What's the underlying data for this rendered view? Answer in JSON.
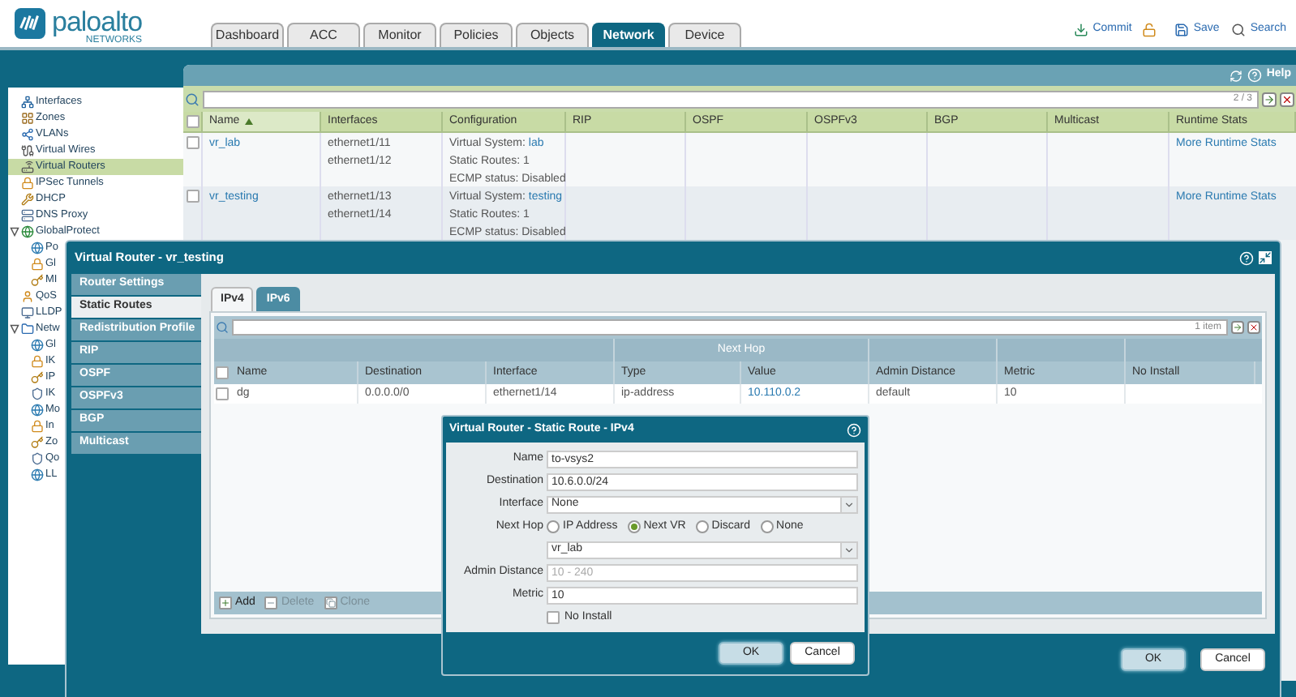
{
  "logo": {
    "brand": "paloalto",
    "sub": "NETWORKS"
  },
  "tabs": [
    {
      "label": "Dashboard",
      "selected": false
    },
    {
      "label": "ACC",
      "selected": false
    },
    {
      "label": "Monitor",
      "selected": false
    },
    {
      "label": "Policies",
      "selected": false
    },
    {
      "label": "Objects",
      "selected": false
    },
    {
      "label": "Network",
      "selected": true
    },
    {
      "label": "Device",
      "selected": false
    }
  ],
  "actions": [
    "Commit",
    "Save",
    "Search"
  ],
  "sidebar": {
    "items": [
      {
        "label": "Interfaces",
        "selected": false
      },
      {
        "label": "Zones",
        "selected": false
      },
      {
        "label": "VLANs",
        "selected": false
      },
      {
        "label": "Virtual Wires",
        "selected": false
      },
      {
        "label": "Virtual Routers",
        "selected": true
      },
      {
        "label": "IPSec Tunnels",
        "selected": false
      },
      {
        "label": "DHCP",
        "selected": false
      },
      {
        "label": "DNS Proxy",
        "selected": false
      },
      {
        "label": "GlobalProtect",
        "selected": false,
        "expanded": true,
        "children": [
          {
            "label": "Po",
            "selected": false
          },
          {
            "label": "Gl",
            "selected": false
          },
          {
            "label": "MI",
            "selected": false
          }
        ]
      },
      {
        "label": "QoS",
        "selected": false
      },
      {
        "label": "LLDP",
        "selected": false
      },
      {
        "label": "Netw",
        "selected": false,
        "expanded": true,
        "children": [
          {
            "label": "Gl",
            "selected": false
          },
          {
            "label": "IK",
            "selected": false
          },
          {
            "label": "IP",
            "selected": false
          },
          {
            "label": "IK",
            "selected": false
          },
          {
            "label": "Mo",
            "selected": false
          },
          {
            "label": "In",
            "selected": false
          },
          {
            "label": "Zo",
            "selected": false
          },
          {
            "label": "Qo",
            "selected": false
          },
          {
            "label": "LL",
            "selected": false
          }
        ]
      }
    ]
  },
  "panel": {
    "help": "Help",
    "count": "2 / 3",
    "all_checked": false,
    "columns": [
      {
        "label": "Name",
        "sorted": true
      },
      {
        "label": "Interfaces",
        "sorted": false
      },
      {
        "label": "Configuration",
        "sorted": false
      },
      {
        "label": "RIP",
        "sorted": false
      },
      {
        "label": "OSPF",
        "sorted": false
      },
      {
        "label": "OSPFv3",
        "sorted": false
      },
      {
        "label": "BGP",
        "sorted": false
      },
      {
        "label": "Multicast",
        "sorted": false
      },
      {
        "label": "Runtime Stats",
        "sorted": false
      }
    ],
    "rows": [
      {
        "checked": false,
        "name": "vr_lab",
        "interfaces": [
          "ethernet1/11",
          "ethernet1/12"
        ],
        "configuration": [
          {
            "text": "Virtual System:",
            "link": "lab"
          },
          {
            "text": "Static Routes: 1"
          },
          {
            "text": "ECMP status: Disabled"
          }
        ],
        "runtime": "More Runtime Stats"
      },
      {
        "checked": false,
        "name": "vr_testing",
        "interfaces": [
          "ethernet1/13",
          "ethernet1/14"
        ],
        "configuration": [
          {
            "text": "Virtual System:",
            "link": "testing"
          },
          {
            "text": "Static Routes: 1"
          },
          {
            "text": "ECMP status: Disabled"
          }
        ],
        "runtime": "More Runtime Stats"
      }
    ]
  },
  "router_dialog": {
    "title": "Virtual Router - vr_testing",
    "nav": [
      {
        "label": "Router Settings",
        "selected": false
      },
      {
        "label": "Static Routes",
        "selected": true
      },
      {
        "label": "Redistribution Profile",
        "selected": false
      },
      {
        "label": "RIP",
        "selected": false
      },
      {
        "label": "OSPF",
        "selected": false
      },
      {
        "label": "OSPFv3",
        "selected": false
      },
      {
        "label": "BGP",
        "selected": false
      },
      {
        "label": "Multicast",
        "selected": false
      }
    ],
    "tabs": [
      {
        "label": "IPv4",
        "selected": true
      },
      {
        "label": "IPv6",
        "selected": false
      }
    ],
    "count": "1 item",
    "group_header": "Next Hop",
    "all_checked": false,
    "columns": [
      "Name",
      "Destination",
      "Interface",
      "Type",
      "Value",
      "Admin Distance",
      "Metric",
      "No Install"
    ],
    "rows": [
      {
        "checked": false,
        "cells": [
          "dg",
          "0.0.0.0/0",
          "ethernet1/14",
          "ip-address",
          "10.110.0.2",
          "default",
          "10"
        ]
      }
    ],
    "actions": [
      {
        "label": "Add",
        "disabled": false
      },
      {
        "label": "Delete",
        "disabled": true
      },
      {
        "label": "Clone",
        "disabled": true
      }
    ],
    "buttons": [
      "OK",
      "Cancel"
    ]
  },
  "route_dialog": {
    "title": "Virtual Router - Static Route - IPv4",
    "fields": [
      {
        "kind": "text",
        "label": "Name",
        "value": "to-vsys2"
      },
      {
        "kind": "text",
        "label": "Destination",
        "value": "10.6.0.0/24"
      },
      {
        "kind": "select",
        "label": "Interface",
        "value": "None"
      },
      {
        "kind": "radio",
        "label": "Next Hop",
        "options": [
          {
            "label": "IP Address",
            "selected": false
          },
          {
            "label": "Next VR",
            "selected": true
          },
          {
            "label": "Discard",
            "selected": false
          },
          {
            "label": "None",
            "selected": false
          }
        ]
      },
      {
        "kind": "select",
        "value": "vr_lab"
      },
      {
        "kind": "text",
        "label": "Admin Distance",
        "placeholder": "10 - 240"
      },
      {
        "kind": "text",
        "label": "Metric",
        "value": "10"
      },
      {
        "kind": "checkbox",
        "label": "No Install",
        "checked": false
      }
    ],
    "buttons": [
      "OK",
      "Cancel"
    ]
  }
}
